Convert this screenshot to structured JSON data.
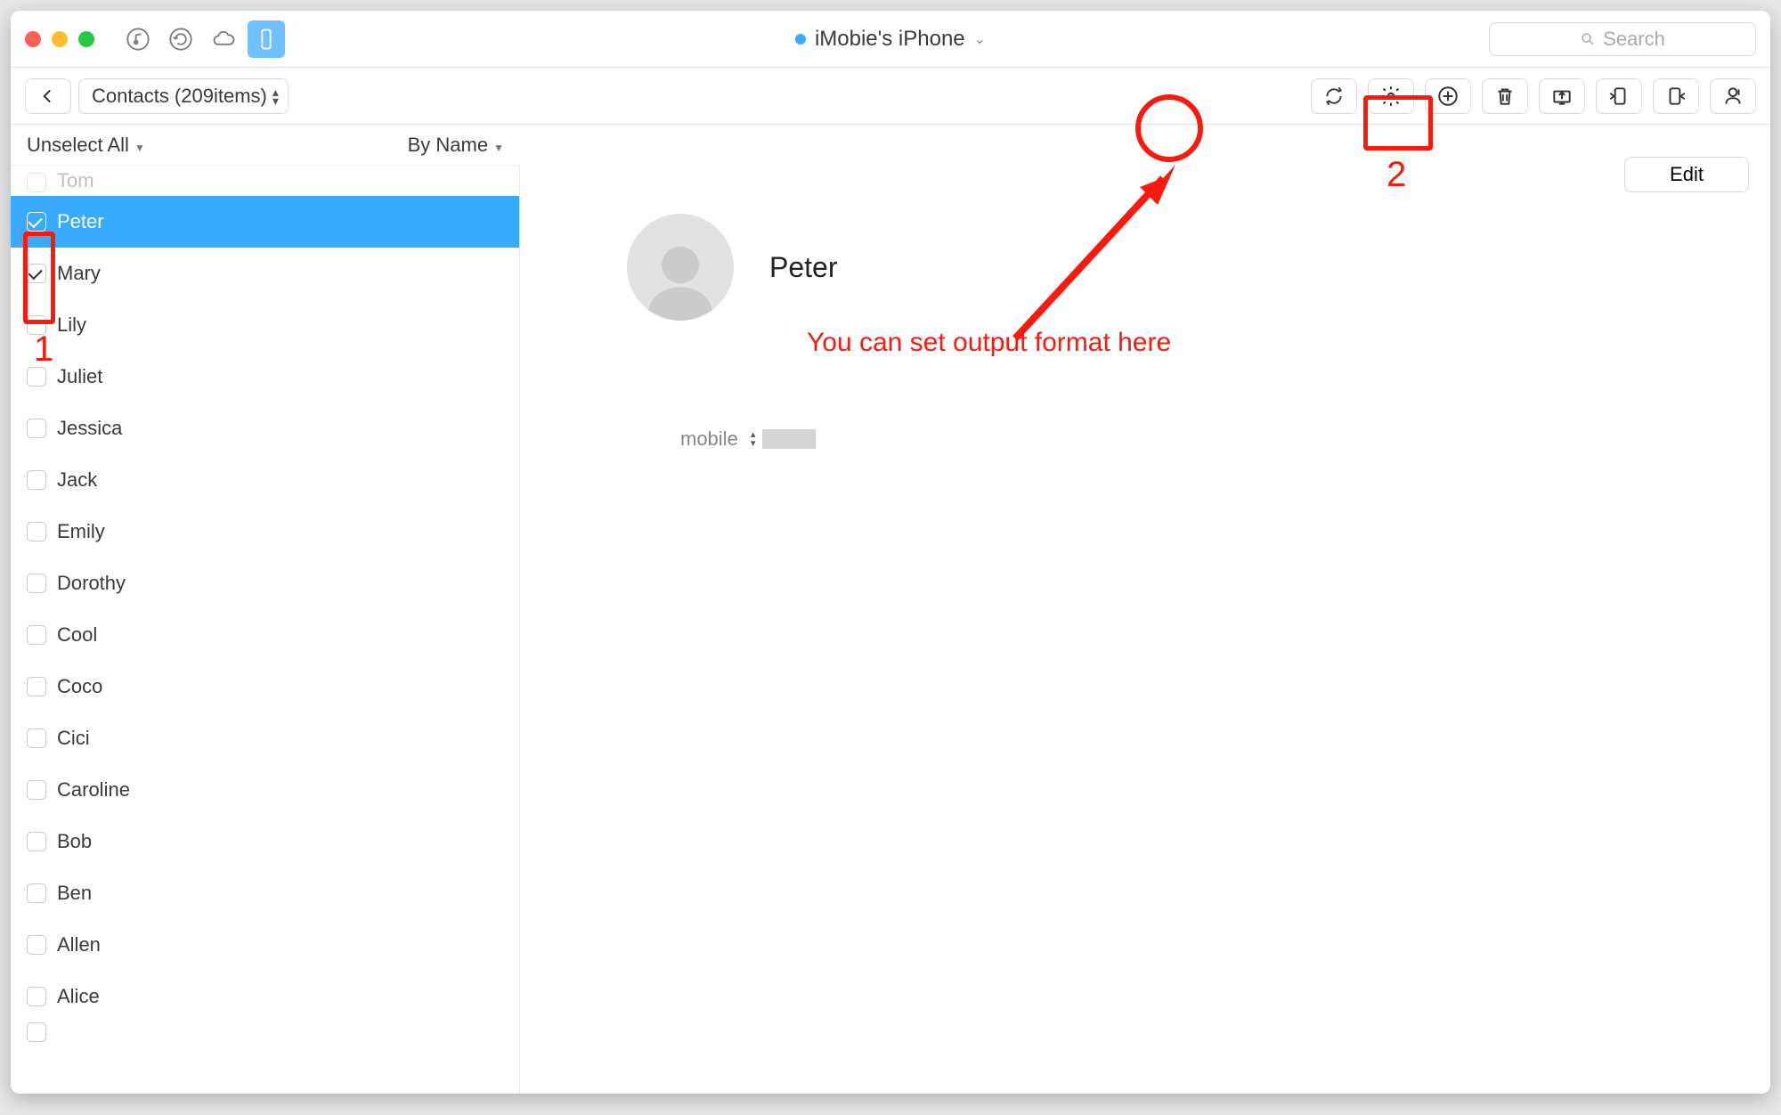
{
  "titlebar": {
    "device_name": "iMobie's iPhone",
    "search_placeholder": "Search"
  },
  "toolbar": {
    "breadcrumb": "Contacts (209items)"
  },
  "list_header": {
    "unselect": "Unselect All",
    "sort": "By Name"
  },
  "contacts": [
    {
      "name": "Tom",
      "checked": false,
      "partial_top": true
    },
    {
      "name": "Peter",
      "checked": true,
      "selected": true
    },
    {
      "name": "Mary",
      "checked": true
    },
    {
      "name": "Lily",
      "checked": false
    },
    {
      "name": "Juliet",
      "checked": false
    },
    {
      "name": "Jessica",
      "checked": false
    },
    {
      "name": "Jack",
      "checked": false
    },
    {
      "name": "Emily",
      "checked": false
    },
    {
      "name": "Dorothy",
      "checked": false
    },
    {
      "name": "Cool",
      "checked": false
    },
    {
      "name": "Coco",
      "checked": false
    },
    {
      "name": "Cici",
      "checked": false
    },
    {
      "name": "Caroline",
      "checked": false
    },
    {
      "name": "Bob",
      "checked": false
    },
    {
      "name": "Ben",
      "checked": false
    },
    {
      "name": "Allen",
      "checked": false
    },
    {
      "name": "Alice",
      "checked": false
    },
    {
      "name": "",
      "checked": false,
      "partial_bottom": true
    }
  ],
  "detail": {
    "edit": "Edit",
    "name": "Peter",
    "phone_label": "mobile"
  },
  "annotations": {
    "step1": "1",
    "step2": "2",
    "text": "You can set output format here"
  }
}
